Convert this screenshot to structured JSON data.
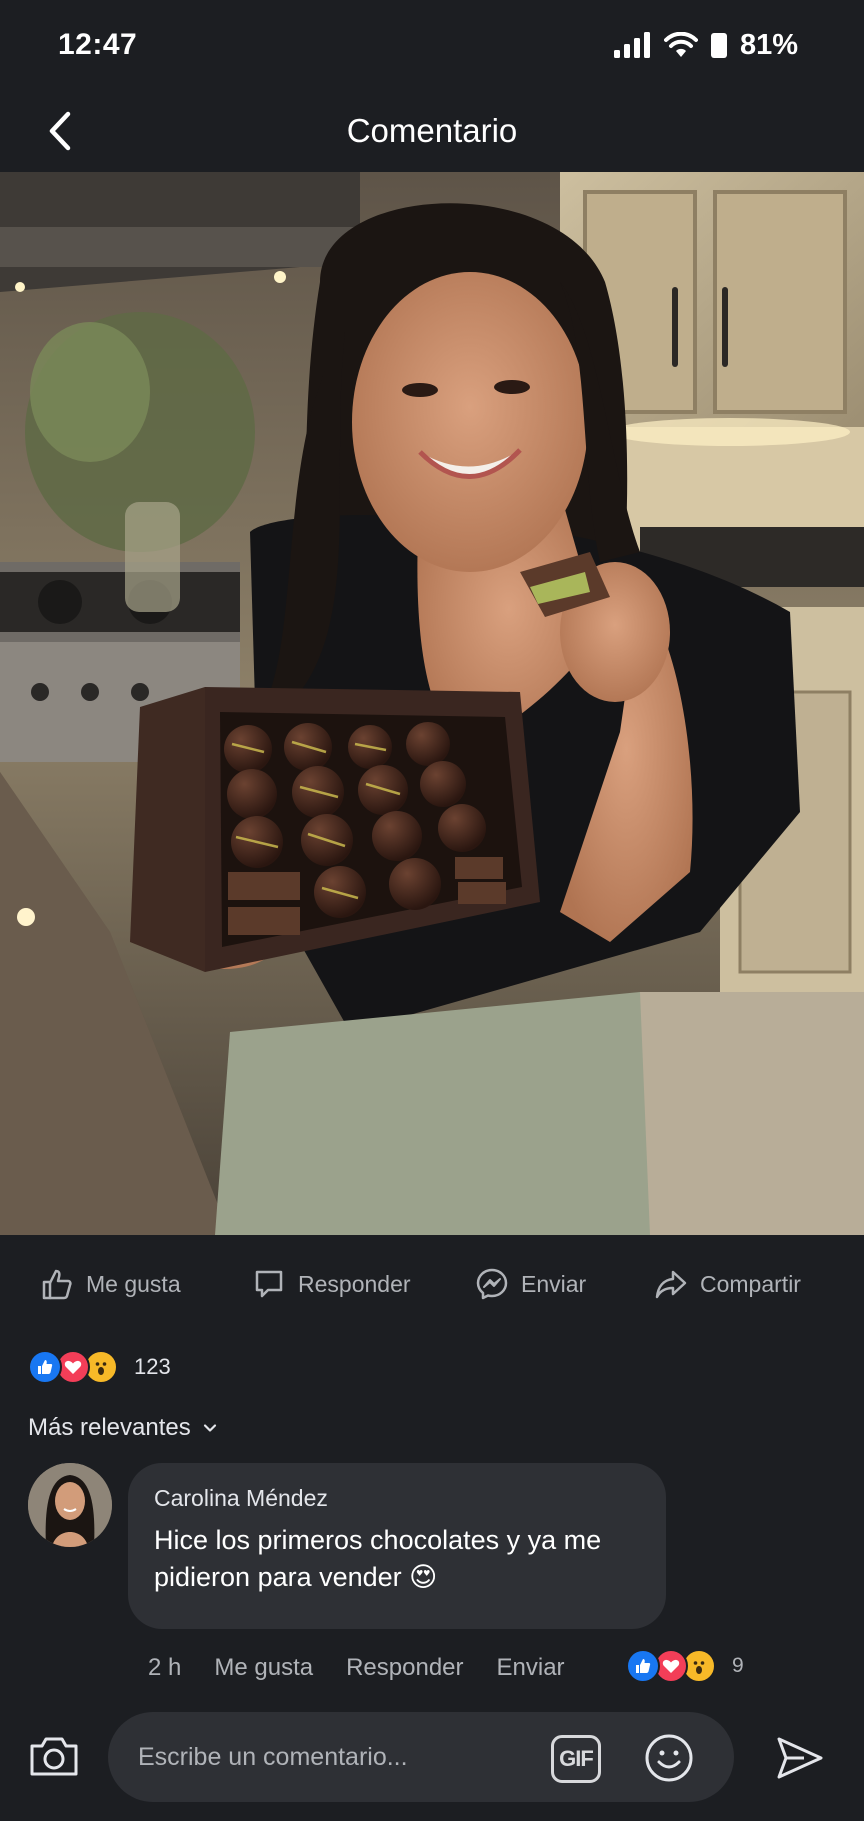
{
  "status_bar": {
    "time": "12:47",
    "battery": "81%"
  },
  "header": {
    "title": "Comentario"
  },
  "post_actions": [
    {
      "label": "Me gusta",
      "icon": "thumbs-up-icon"
    },
    {
      "label": "Responder",
      "icon": "comment-icon"
    },
    {
      "label": "Enviar",
      "icon": "messenger-icon"
    },
    {
      "label": "Compartir",
      "icon": "share-icon"
    }
  ],
  "reactions": {
    "count": "123",
    "types": [
      "like",
      "love",
      "wow"
    ]
  },
  "sort": {
    "label": "Más relevantes"
  },
  "comment": {
    "author": "Carolina Méndez",
    "text": "Hice los primeros chocolates y ya me pidieron para vender 😍",
    "time": "2 h",
    "like_label": "Me gusta",
    "reply_label": "Responder",
    "send_label": "Enviar",
    "reaction_count": "9"
  },
  "composer": {
    "placeholder": "Escribe un comentario...",
    "gif_label": "GIF"
  },
  "colors": {
    "background": "#1c1e22",
    "bubble": "#2e3035",
    "like": "#1877f2",
    "love": "#f33e58",
    "wow": "#f7b928"
  }
}
